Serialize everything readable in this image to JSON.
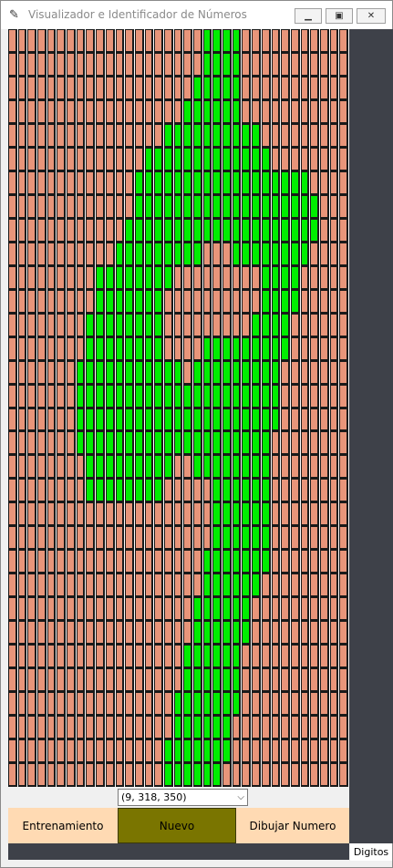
{
  "window": {
    "title": "Visualizador e Identificador de Números",
    "icon": "feather-icon",
    "controls": [
      "minimize-icon",
      "maximize-icon",
      "close-icon"
    ]
  },
  "grid": {
    "rows": 32,
    "cols": 35,
    "off_color": "#e8957a",
    "on_color": "#00ee00",
    "column_gap_color": "#ffffff",
    "on_runs": [
      [
        [
          20,
          23
        ]
      ],
      [
        [
          20,
          23
        ]
      ],
      [
        [
          19,
          23
        ]
      ],
      [
        [
          18,
          23
        ]
      ],
      [
        [
          16,
          25
        ]
      ],
      [
        [
          14,
          26
        ]
      ],
      [
        [
          13,
          30
        ]
      ],
      [
        [
          13,
          31
        ]
      ],
      [
        [
          12,
          31
        ]
      ],
      [
        [
          11,
          19
        ],
        [
          23,
          30
        ]
      ],
      [
        [
          9,
          16
        ],
        [
          26,
          29
        ]
      ],
      [
        [
          9,
          15
        ],
        [
          26,
          29
        ]
      ],
      [
        [
          8,
          15
        ],
        [
          25,
          28
        ]
      ],
      [
        [
          8,
          15
        ],
        [
          20,
          28
        ]
      ],
      [
        [
          7,
          17
        ],
        [
          19,
          27
        ]
      ],
      [
        [
          7,
          27
        ]
      ],
      [
        [
          7,
          27
        ]
      ],
      [
        [
          7,
          26
        ]
      ],
      [
        [
          8,
          16
        ],
        [
          19,
          26
        ]
      ],
      [
        [
          8,
          15
        ],
        [
          21,
          26
        ]
      ],
      [
        [
          21,
          26
        ]
      ],
      [
        [
          21,
          26
        ]
      ],
      [
        [
          20,
          26
        ]
      ],
      [
        [
          20,
          25
        ]
      ],
      [
        [
          19,
          24
        ]
      ],
      [
        [
          19,
          24
        ]
      ],
      [
        [
          18,
          23
        ]
      ],
      [
        [
          18,
          23
        ]
      ],
      [
        [
          17,
          23
        ]
      ],
      [
        [
          17,
          22
        ]
      ],
      [
        [
          16,
          22
        ]
      ],
      [
        [
          16,
          21
        ]
      ]
    ]
  },
  "combo": {
    "value": "(9, 318, 350)"
  },
  "buttons": {
    "train": "Entrenamiento",
    "new": "Nuevo",
    "draw": "Dibujar Numero"
  },
  "side_label": "Digitos",
  "colors": {
    "sidebar": "#3e4149",
    "button_light": "#ffdab3",
    "button_active": "#7a7500"
  }
}
